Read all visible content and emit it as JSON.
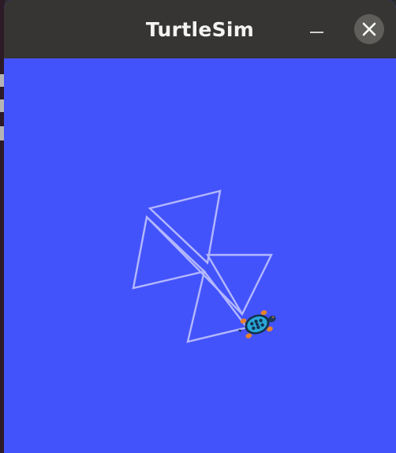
{
  "window": {
    "title": "TurtleSim",
    "minimize_icon": "minimize-icon",
    "close_icon": "close-icon"
  },
  "canvas": {
    "background_color": "#4353fb",
    "pen_color": "#b3b8ff",
    "turtle_icon": "turtle-icon"
  },
  "titlebar_color": "#363533"
}
